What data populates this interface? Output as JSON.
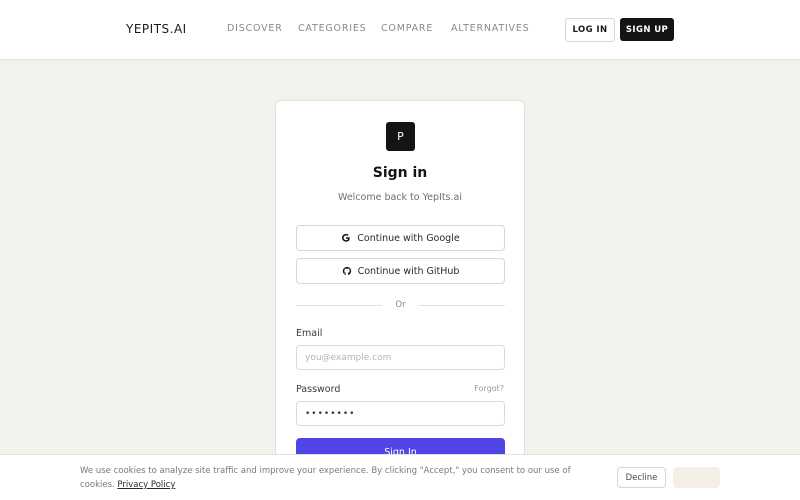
{
  "header": {
    "brand": "YEPITS.AI",
    "nav": [
      "DISCOVER",
      "CATEGORIES",
      "COMPARE",
      "ALTERNATIVES"
    ],
    "login_label": "LOG IN",
    "signup_label": "SIGN UP"
  },
  "card": {
    "logo_letter": "P",
    "title": "Sign in",
    "subtitle": "Welcome back to YepIts.ai",
    "google_label": "Continue with Google",
    "github_label": "Continue with GitHub",
    "divider_text": "Or",
    "email_label": "Email",
    "email_placeholder": "you@example.com",
    "password_label": "Password",
    "forgot_label": "Forgot?",
    "password_value": "••••••••",
    "submit_label": "Sign In"
  },
  "cookie": {
    "message": "We use cookies to analyze site traffic and improve your experience. By clicking \"Accept,\" you consent to our use of cookies.",
    "policy_link": "Privacy Policy",
    "decline_label": "Decline",
    "accept_label": "Accept"
  },
  "colors": {
    "accent": "#4f46e5",
    "background": "#f3f1ec",
    "dark": "#141414"
  }
}
